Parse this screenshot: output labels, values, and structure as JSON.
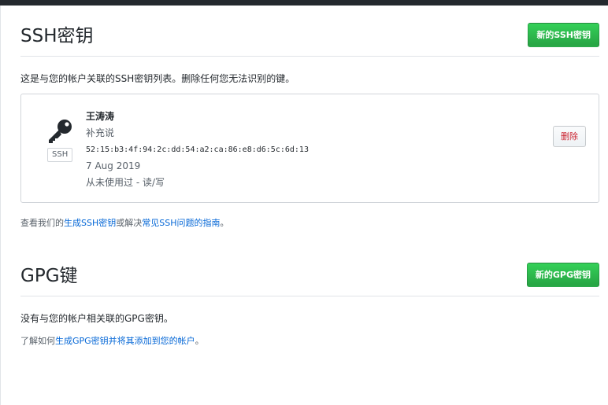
{
  "ssh": {
    "title": "SSH密钥",
    "new_button": "新的SSH密钥",
    "description": "这是与您的帐户关联的SSH密钥列表。删除任何您无法识别的键。",
    "keys": [
      {
        "title": "王涛涛",
        "note": "补充说",
        "badge": "SSH",
        "fingerprint": "52:15:b3:4f:94:2c:dd:54:a2:ca:86:e8:d6:5c:6d:13",
        "date": "7 Aug 2019",
        "usage": "从未使用过 - 读/写",
        "delete_label": "删除"
      }
    ],
    "help_prefix": "查看我们的",
    "help_link1": "生成SSH密钥",
    "help_middle": "或解决",
    "help_link2": "常见SSH问题的指南",
    "help_suffix": "。"
  },
  "gpg": {
    "title": "GPG键",
    "new_button": "新的GPG密钥",
    "description": "没有与您的帐户相关联的GPG密钥。",
    "help_prefix": "了解如何",
    "help_link": "生成GPG密钥并将其添加到您的帐户",
    "help_suffix": "。"
  },
  "icons": {
    "key": "key-icon"
  },
  "colors": {
    "primary_button": "#28a745",
    "link": "#0366d6",
    "danger": "#cb2431"
  }
}
